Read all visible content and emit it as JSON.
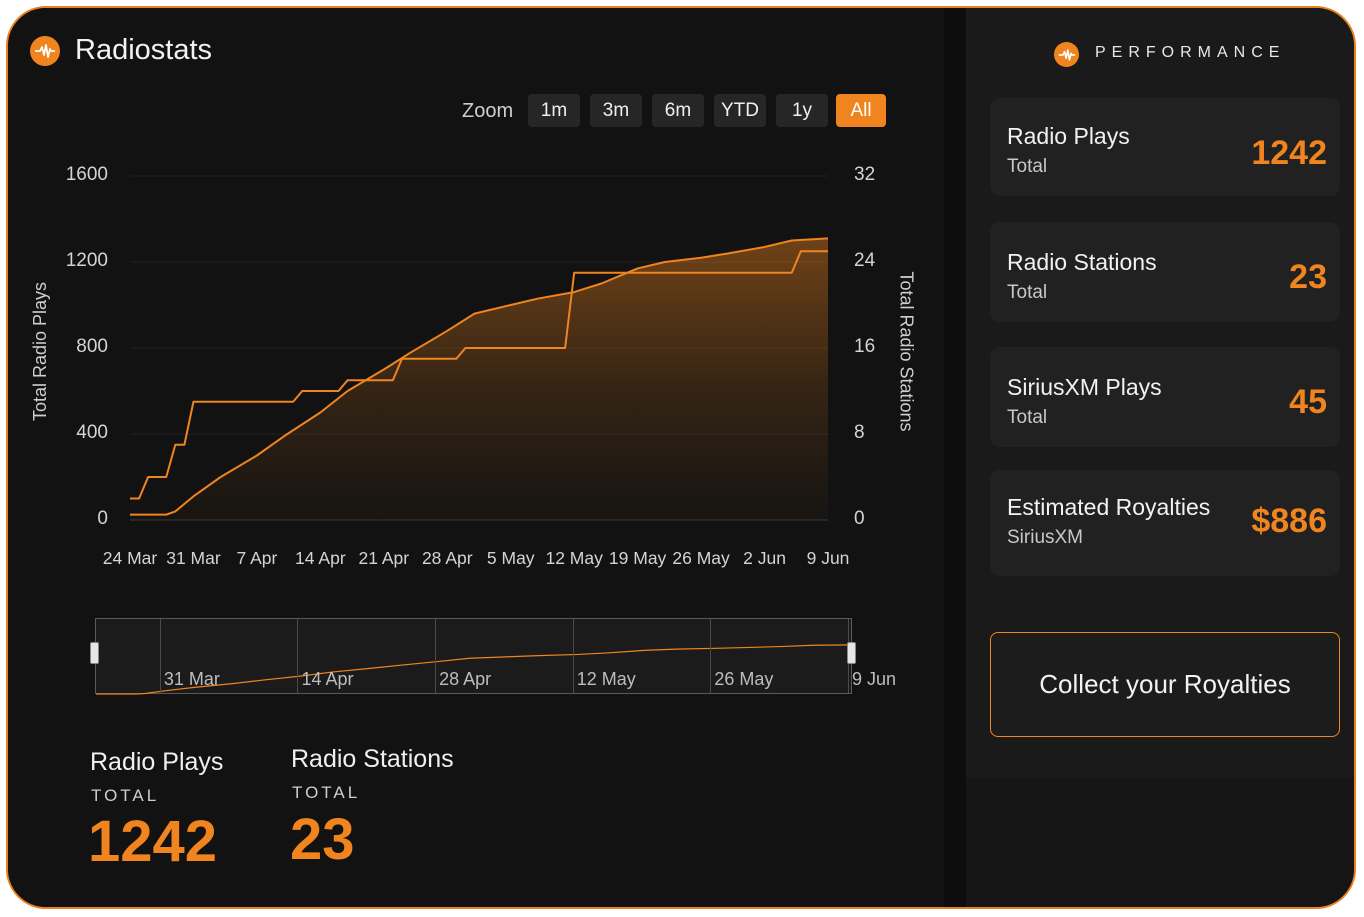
{
  "app": {
    "title": "Radiostats"
  },
  "zoom": {
    "label": "Zoom",
    "options": [
      "1m",
      "3m",
      "6m",
      "YTD",
      "1y",
      "All"
    ],
    "active": "All"
  },
  "chart_data": {
    "type": "line",
    "title": "",
    "ylabel": "Total Radio Plays",
    "y2label": "Total Radio Stations",
    "ylim": [
      0,
      1600
    ],
    "y2lim": [
      0,
      32
    ],
    "yticks": [
      "0",
      "400",
      "800",
      "1200",
      "1600"
    ],
    "y2ticks": [
      "0",
      "8",
      "16",
      "24",
      "32"
    ],
    "xticks": [
      "24 Mar",
      "31 Mar",
      "7 Apr",
      "14 Apr",
      "21 Apr",
      "28 Apr",
      "5 May",
      "12 May",
      "19 May",
      "26 May",
      "2 Jun",
      "9 Jun"
    ],
    "xlim": [
      "2024-03-24",
      "2024-06-09"
    ],
    "series": [
      {
        "name": "Total Radio Plays",
        "axis": "left",
        "style": "line-area",
        "points": [
          [
            "2024-03-24",
            25
          ],
          [
            "2024-03-28",
            25
          ],
          [
            "2024-03-29",
            40
          ],
          [
            "2024-03-31",
            110
          ],
          [
            "2024-04-03",
            200
          ],
          [
            "2024-04-07",
            300
          ],
          [
            "2024-04-10",
            390
          ],
          [
            "2024-04-14",
            500
          ],
          [
            "2024-04-17",
            600
          ],
          [
            "2024-04-21",
            700
          ],
          [
            "2024-04-24",
            780
          ],
          [
            "2024-04-28",
            880
          ],
          [
            "2024-05-01",
            960
          ],
          [
            "2024-05-05",
            1000
          ],
          [
            "2024-05-08",
            1030
          ],
          [
            "2024-05-12",
            1060
          ],
          [
            "2024-05-15",
            1100
          ],
          [
            "2024-05-19",
            1170
          ],
          [
            "2024-05-22",
            1200
          ],
          [
            "2024-05-26",
            1220
          ],
          [
            "2024-05-29",
            1240
          ],
          [
            "2024-06-02",
            1270
          ],
          [
            "2024-06-05",
            1300
          ],
          [
            "2024-06-09",
            1310
          ]
        ]
      },
      {
        "name": "Total Radio Stations",
        "axis": "right",
        "style": "step",
        "points": [
          [
            "2024-03-24",
            2
          ],
          [
            "2024-03-25",
            2
          ],
          [
            "2024-03-26",
            4
          ],
          [
            "2024-03-28",
            4
          ],
          [
            "2024-03-29",
            7
          ],
          [
            "2024-03-30",
            7
          ],
          [
            "2024-03-31",
            11
          ],
          [
            "2024-04-11",
            11
          ],
          [
            "2024-04-12",
            12
          ],
          [
            "2024-04-16",
            12
          ],
          [
            "2024-04-17",
            13
          ],
          [
            "2024-04-22",
            13
          ],
          [
            "2024-04-23",
            15
          ],
          [
            "2024-04-29",
            15
          ],
          [
            "2024-04-30",
            16
          ],
          [
            "2024-05-11",
            16
          ],
          [
            "2024-05-12",
            23
          ],
          [
            "2024-06-05",
            23
          ],
          [
            "2024-06-06",
            25
          ],
          [
            "2024-06-09",
            25
          ]
        ]
      }
    ],
    "grid": true,
    "legend": "none"
  },
  "navigator": {
    "labels": [
      "31 Mar",
      "14 Apr",
      "28 Apr",
      "12 May",
      "26 May",
      "9 Jun"
    ]
  },
  "totals": [
    {
      "title": "Radio Plays",
      "sub": "TOTAL",
      "value": "1242"
    },
    {
      "title": "Radio Stations",
      "sub": "TOTAL",
      "value": "23"
    }
  ],
  "performance": {
    "label": "PERFORMANCE",
    "cards": [
      {
        "title": "Radio Plays",
        "sub": "Total",
        "value": "1242"
      },
      {
        "title": "Radio Stations",
        "sub": "Total",
        "value": "23"
      },
      {
        "title": "SiriusXM Plays",
        "sub": "Total",
        "value": "45"
      },
      {
        "title": "Estimated Royalties",
        "sub": "SiriusXM",
        "value": "$886"
      }
    ],
    "cta": "Collect your Royalties"
  },
  "colors": {
    "accent": "#f0841e",
    "background": "#121212",
    "card": "#212121"
  }
}
